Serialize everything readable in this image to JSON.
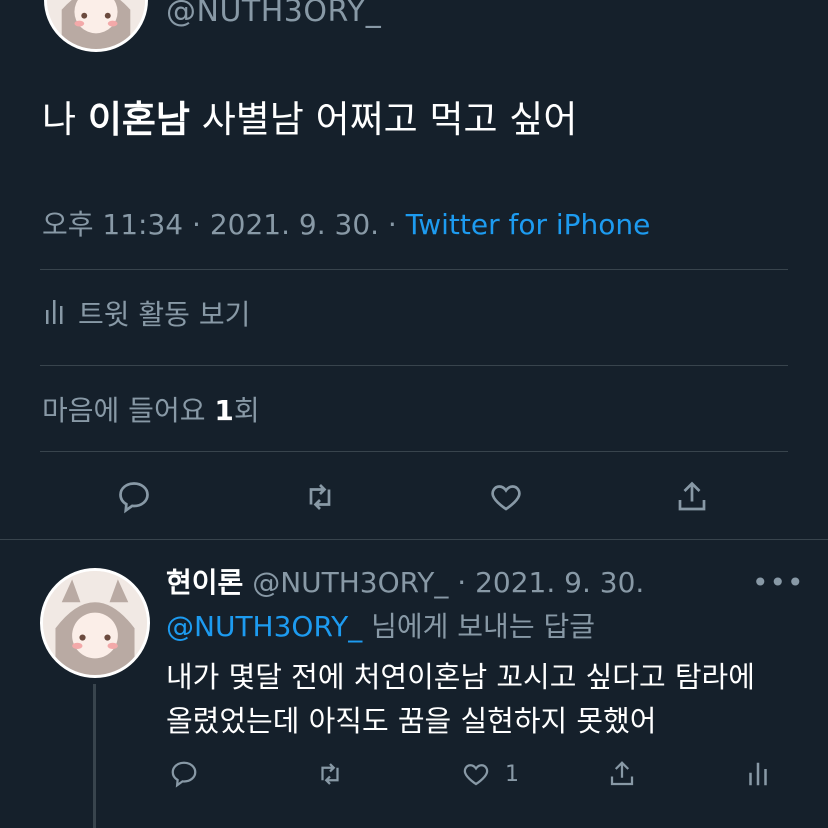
{
  "main_tweet": {
    "handle": "@NUTH3ORY_",
    "text_prefix": "나 ",
    "text_bold": "이혼남",
    "text_suffix": " 사별남 어쩌고 먹고 싶어",
    "time": "오후 11:34",
    "date": "2021. 9. 30.",
    "source": "Twitter for iPhone",
    "activity_label": "트윗 활동 보기",
    "likes_label_prefix": "마음에 들어요 ",
    "likes_count": "1",
    "likes_label_suffix": "회"
  },
  "reply": {
    "name": "현이론",
    "handle": "@NUTH3ORY_",
    "date": "2021. 9. 30.",
    "replying_handle": "@NUTH3ORY_",
    "replying_suffix": " 님에게 보내는 답글",
    "body_line1": "내가 몇달 전에 처연이혼남 꼬시고 싶다고 탐라에",
    "body_line2": "올렸었는데 아직도 꿈을 실현하지 못했어",
    "like_count": "1"
  },
  "icons": {
    "reply": "reply-icon",
    "retweet": "retweet-icon",
    "like": "heart-icon",
    "share": "share-icon",
    "analytics": "analytics-icon",
    "more": "more-icon"
  },
  "colors": {
    "background": "#15202b",
    "accent": "#1d9bf0",
    "muted": "#8899a6",
    "divider": "#38444d"
  }
}
